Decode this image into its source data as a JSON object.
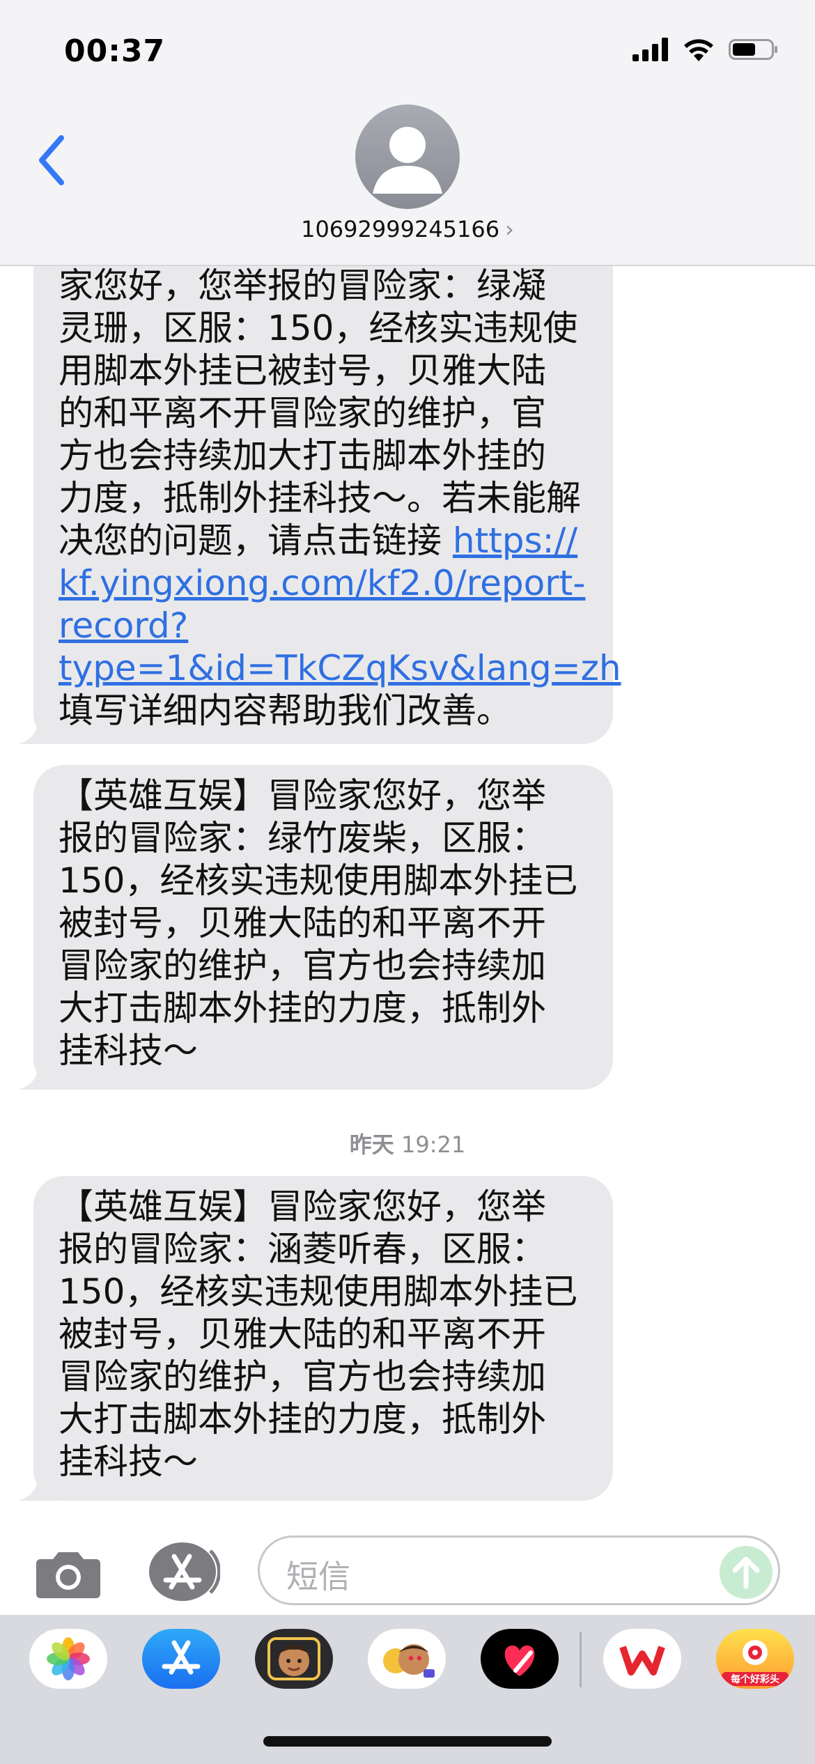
{
  "status_bar": {
    "time": "00:37"
  },
  "header": {
    "contact": "10692999245166",
    "chevron": "›"
  },
  "messages": [
    {
      "lines": [
        "家您好，您举报的冒险家：绿凝",
        "灵珊，区服：150，经核实违规使",
        "用脚本外挂已被封号，贝雅大陆",
        "的和平离不开冒险家的维护，官",
        "方也会持续加大打击脚本外挂的",
        "力度，抵制外挂科技～。若未能解"
      ],
      "line7_text": "决您的问题，请点击链接 ",
      "link_lines": [
        "https://",
        "kf.yingxiong.com/kf2.0/report-",
        "record?",
        "type=1&id=TkCZqKsv&lang=zh"
      ],
      "last_line": "填写详细内容帮助我们改善。"
    },
    {
      "lines": [
        "【英雄互娱】冒险家您好，您举",
        "报的冒险家：绿竹废柴，区服：",
        "150，经核实违规使用脚本外挂已",
        "被封号，贝雅大陆的和平离不开",
        "冒险家的维护，官方也会持续加",
        "大打击脚本外挂的力度，抵制外",
        "挂科技～"
      ]
    },
    {
      "lines": [
        "【英雄互娱】冒险家您好，您举",
        "报的冒险家：涵菱听春，区服：",
        "150，经核实违规使用脚本外挂已",
        "被封号，贝雅大陆的和平离不开",
        "冒险家的维护，官方也会持续加",
        "大打击脚本外挂的力度，抵制外",
        "挂科技～"
      ]
    }
  ],
  "timestamp": {
    "day": "昨天",
    "time": "19:21"
  },
  "input": {
    "placeholder": "短信"
  },
  "drawer": {
    "apps": [
      "photos-icon",
      "app-store-icon",
      "memoji-icon",
      "animoji-icon",
      "digital-touch-icon",
      "wps-icon",
      "game-icon"
    ],
    "game_badge": "每个好彩头"
  },
  "colors": {
    "bubble": "#e9e9eb",
    "link": "#2f6fe2",
    "accent": "#3478f6"
  }
}
